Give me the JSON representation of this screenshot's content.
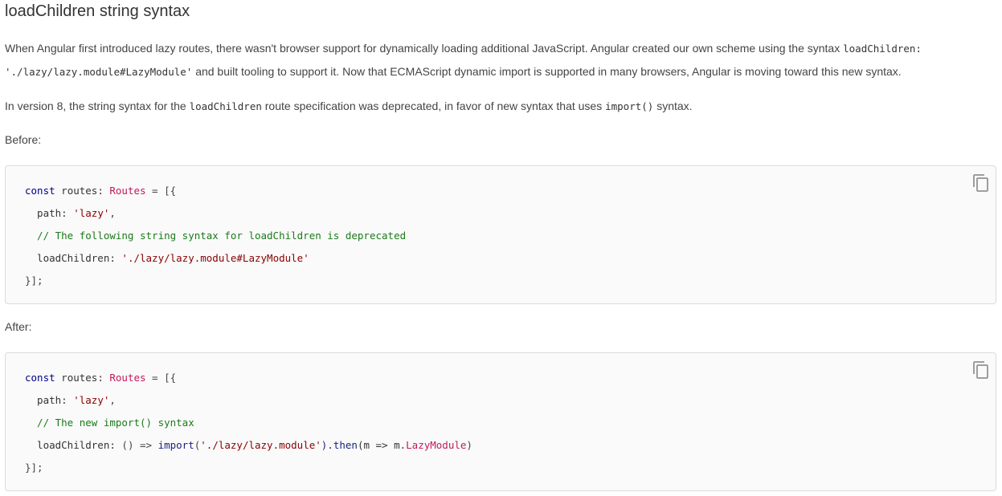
{
  "heading": "loadChildren string syntax",
  "intro": {
    "line1_text": "When Angular first introduced lazy routes, there wasn't browser support for dynamically loading additional JavaScript. Angular created our own scheme using the syntax",
    "line1_code": "loadChildren:",
    "line2_code": "'./lazy/lazy.module#LazyModule'",
    "line2_text": "and built tooling to support it. Now that ECMAScript dynamic import is supported in many browsers, Angular is moving toward this new syntax."
  },
  "version_note": {
    "part1": "In version 8, the string syntax for the",
    "code1": "loadChildren",
    "part2": "route specification was deprecated, in favor of new syntax that uses",
    "code2": "import()",
    "part3": "syntax."
  },
  "before_label": "Before:",
  "after_label": "After:",
  "before_code": {
    "l1": {
      "kw": "const",
      "var": " routes: ",
      "typ": "Routes",
      "rest": " = [{"
    },
    "l2": {
      "key": "  path: ",
      "str": "'lazy'",
      "pun": ","
    },
    "l3": {
      "com": "  // The following string syntax for loadChildren is deprecated"
    },
    "l4": {
      "key": "  loadChildren: ",
      "str": "'./lazy/lazy.module#LazyModule'"
    },
    "l5": {
      "pun": "}];"
    }
  },
  "after_code": {
    "l1": {
      "kw": "const",
      "var": " routes: ",
      "typ": "Routes",
      "rest": " = [{"
    },
    "l2": {
      "key": "  path: ",
      "str": "'lazy'",
      "pun": ","
    },
    "l3": {
      "com": "  // The new import() syntax"
    },
    "l4": {
      "key": "  loadChildren: ",
      "arrow": "() => ",
      "fn": "import",
      "open": "(",
      "str": "'./lazy/lazy.module'",
      "then": ").then",
      "arg": "(m => m.",
      "typ": "LazyModule",
      "close": ")"
    },
    "l5": {
      "pun": "}];"
    }
  },
  "icons": {
    "copy": "copy-icon"
  }
}
